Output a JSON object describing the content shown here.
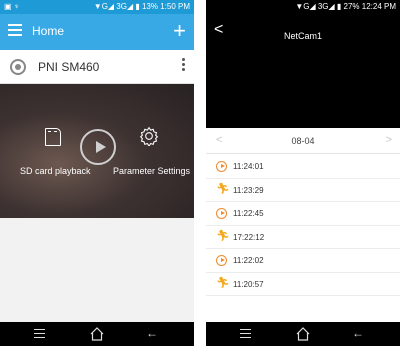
{
  "left": {
    "status": {
      "left_icons": "▣ ♆",
      "right": "▼G◢ 3G◢ ▮ 13% 1:50 PM"
    },
    "appbar": {
      "title": "Home",
      "add_icon": "+"
    },
    "device": {
      "name": "PNI SM460"
    },
    "preview": {
      "sd_label": "SD card playback",
      "settings_label": "Parameter Settings"
    },
    "nav": {
      "home": "⌂",
      "back": "←"
    }
  },
  "right": {
    "status": {
      "right": "▼G◢ 3G◢ ▮ 27% 12:24 PM"
    },
    "video": {
      "title": "NetCam1",
      "back": "<"
    },
    "datebar": {
      "prev": "<",
      "date": "08-04",
      "next": ">"
    },
    "events": [
      {
        "type": "record",
        "time": "11:24:01"
      },
      {
        "type": "motion",
        "time": "11:23:29"
      },
      {
        "type": "record",
        "time": "11:22:45"
      },
      {
        "type": "motion",
        "time": "17:22:12"
      },
      {
        "type": "record",
        "time": "11:22:02"
      },
      {
        "type": "motion",
        "time": "11:20:57"
      }
    ],
    "nav": {
      "home": "⌂",
      "back": "←"
    }
  },
  "colors": {
    "statusbar": "#1e9ad6",
    "appbar": "#39a9e6",
    "record": "#f08a2c",
    "motion": "#f3a81f"
  }
}
